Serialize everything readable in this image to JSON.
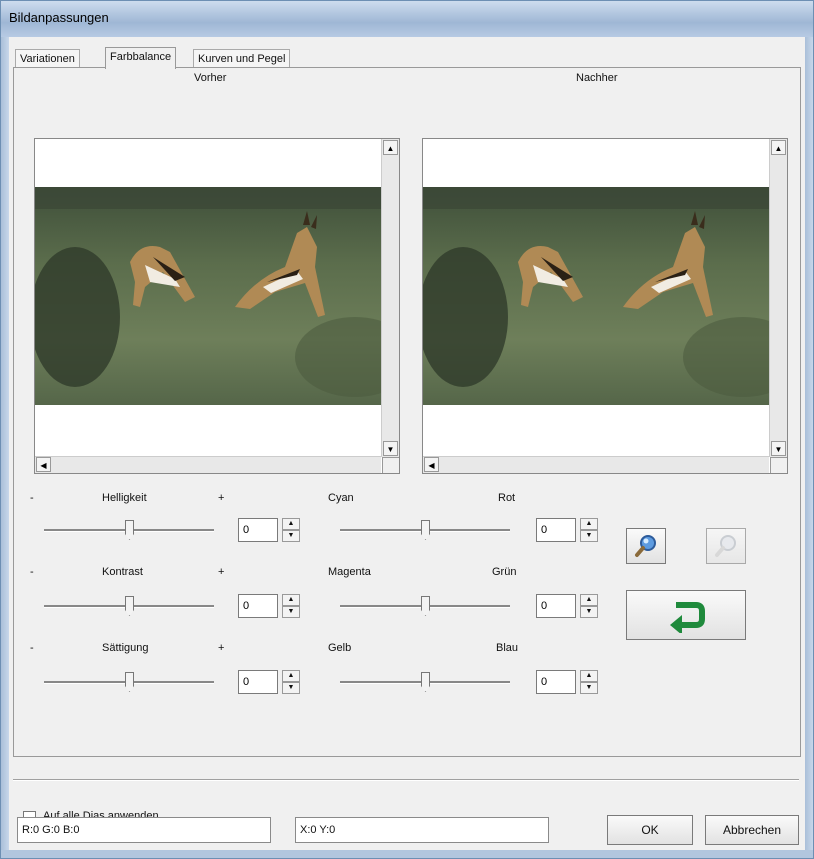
{
  "window": {
    "title": "Bildanpassungen"
  },
  "tabs": [
    {
      "label": "Variationen",
      "active": false
    },
    {
      "label": "Farbbalance",
      "active": true
    },
    {
      "label": "Kurven und Pegel",
      "active": false
    }
  ],
  "preview": {
    "before_label": "Vorher",
    "after_label": "Nachher"
  },
  "left_sliders": [
    {
      "label": "Helligkeit",
      "minus": "-",
      "plus": "+",
      "value": "0"
    },
    {
      "label": "Kontrast",
      "minus": "-",
      "plus": "+",
      "value": "0"
    },
    {
      "label": "Sättigung",
      "minus": "-",
      "plus": "+",
      "value": "0"
    }
  ],
  "color_sliders": [
    {
      "left": "Cyan",
      "right": "Rot",
      "value": "0"
    },
    {
      "left": "Magenta",
      "right": "Grün",
      "value": "0"
    },
    {
      "left": "Gelb",
      "right": "Blau",
      "value": "0"
    }
  ],
  "icons": {
    "zoom_in": "magnifier-icon",
    "zoom_out": "magnifier-disabled-icon",
    "reset": "green-return-arrow-icon"
  },
  "apply_all_label": "Auf alle Dias anwenden",
  "status": {
    "rgb": "R:0 G:0 B:0",
    "xy": "X:0 Y:0"
  },
  "buttons": {
    "ok": "OK",
    "cancel": "Abbrechen"
  },
  "colors": {
    "accent_green": "#1f8a3c",
    "title_blue": "#9fb7d5"
  }
}
